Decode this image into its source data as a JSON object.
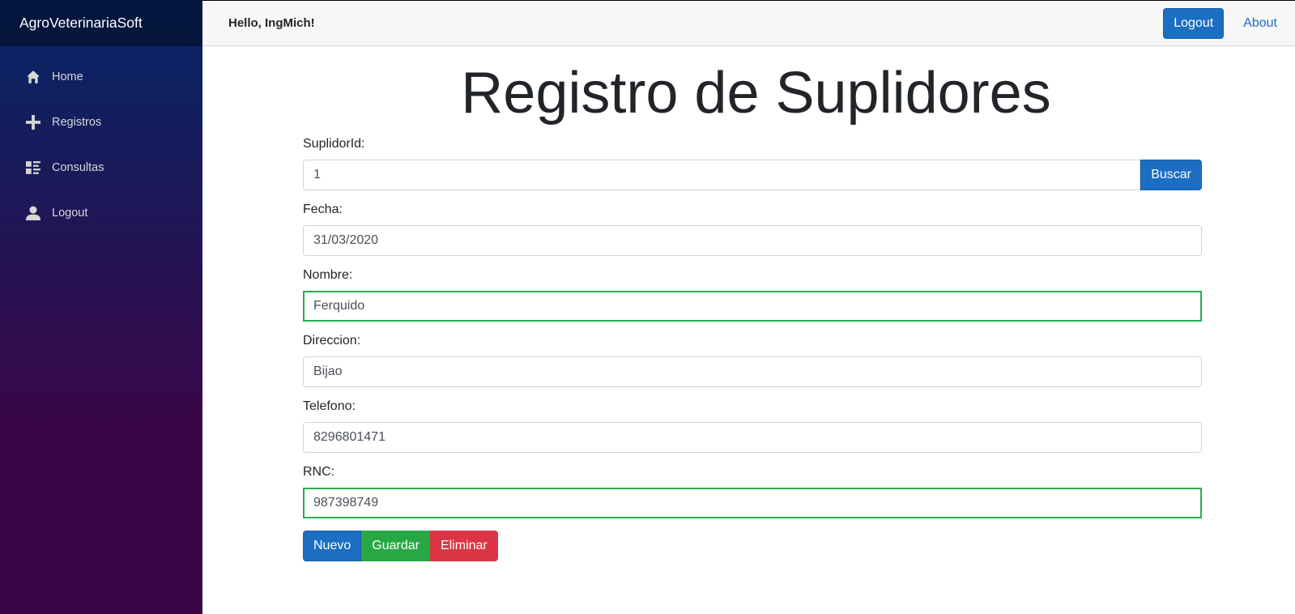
{
  "sidebar": {
    "brand": "AgroVeterinariaSoft",
    "items": [
      {
        "label": "Home",
        "icon": "home-icon"
      },
      {
        "label": "Registros",
        "icon": "plus-icon"
      },
      {
        "label": "Consultas",
        "icon": "list-icon"
      },
      {
        "label": "Logout",
        "icon": "person-icon"
      }
    ]
  },
  "topbar": {
    "greeting": "Hello, IngMich!",
    "logout_label": "Logout",
    "about_label": "About"
  },
  "form": {
    "title": "Registro de Suplidores",
    "suplidor_id": {
      "label": "SuplidorId:",
      "value": "1"
    },
    "buscar_label": "Buscar",
    "fecha": {
      "label": "Fecha:",
      "value": "31/03/2020"
    },
    "nombre": {
      "label": "Nombre:",
      "value": "Ferquido"
    },
    "direccion": {
      "label": "Direccion:",
      "value": "Bijao"
    },
    "telefono": {
      "label": "Telefono:",
      "value": "8296801471"
    },
    "rnc": {
      "label": "RNC:",
      "value": "987398749"
    },
    "nuevo_label": "Nuevo",
    "guardar_label": "Guardar",
    "eliminar_label": "Eliminar"
  },
  "colors": {
    "primary": "#1b6ec2",
    "success": "#28a745",
    "danger": "#dc3545",
    "sidebar_top": "#052767",
    "sidebar_bottom": "#3a0647"
  }
}
